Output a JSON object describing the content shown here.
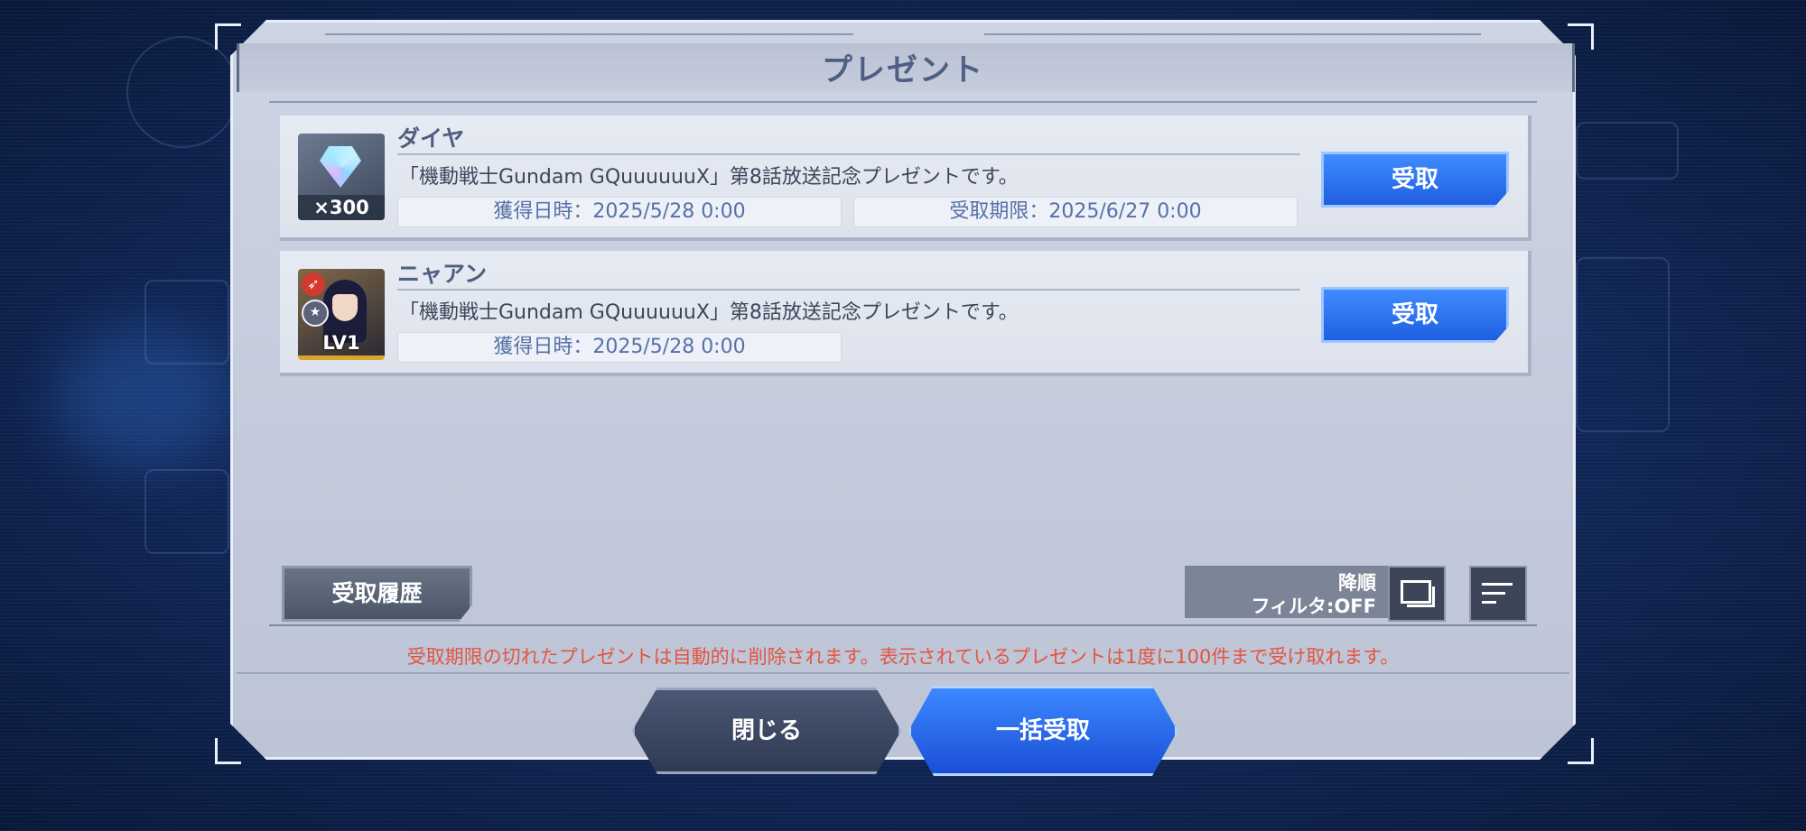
{
  "dialog": {
    "title": "プレゼント",
    "history_button": "受取履歴",
    "sort_order": "降順",
    "filter_state": "フィルタ:OFF",
    "notice": "受取期限の切れたプレゼントは自動的に削除されます。表示されているプレゼントは1度に100件まで受け取れます。",
    "close_button": "閉じる",
    "bulk_claim_button": "一括受取"
  },
  "presents": [
    {
      "name": "ダイヤ",
      "quantity_label": "×300",
      "description": "「機動戦士Gundam GQuuuuuuX」第8話放送記念プレゼントです。",
      "acquired": "獲得日時：2025/5/28 0:00",
      "deadline": "受取期限：2025/6/27 0:00",
      "claim_label": "受取",
      "icon": "diamond-icon"
    },
    {
      "name": "ニャアン",
      "quantity_label": "LV1",
      "description": "「機動戦士Gundam GQuuuuuuX」第8話放送記念プレゼントです。",
      "acquired": "獲得日時：2025/5/28 0:00",
      "claim_label": "受取",
      "icon": "character-portrait"
    }
  ],
  "colors": {
    "accent_blue": "#1f5fe0",
    "notice_red": "#e2553f",
    "title_text": "#4d5f82"
  }
}
